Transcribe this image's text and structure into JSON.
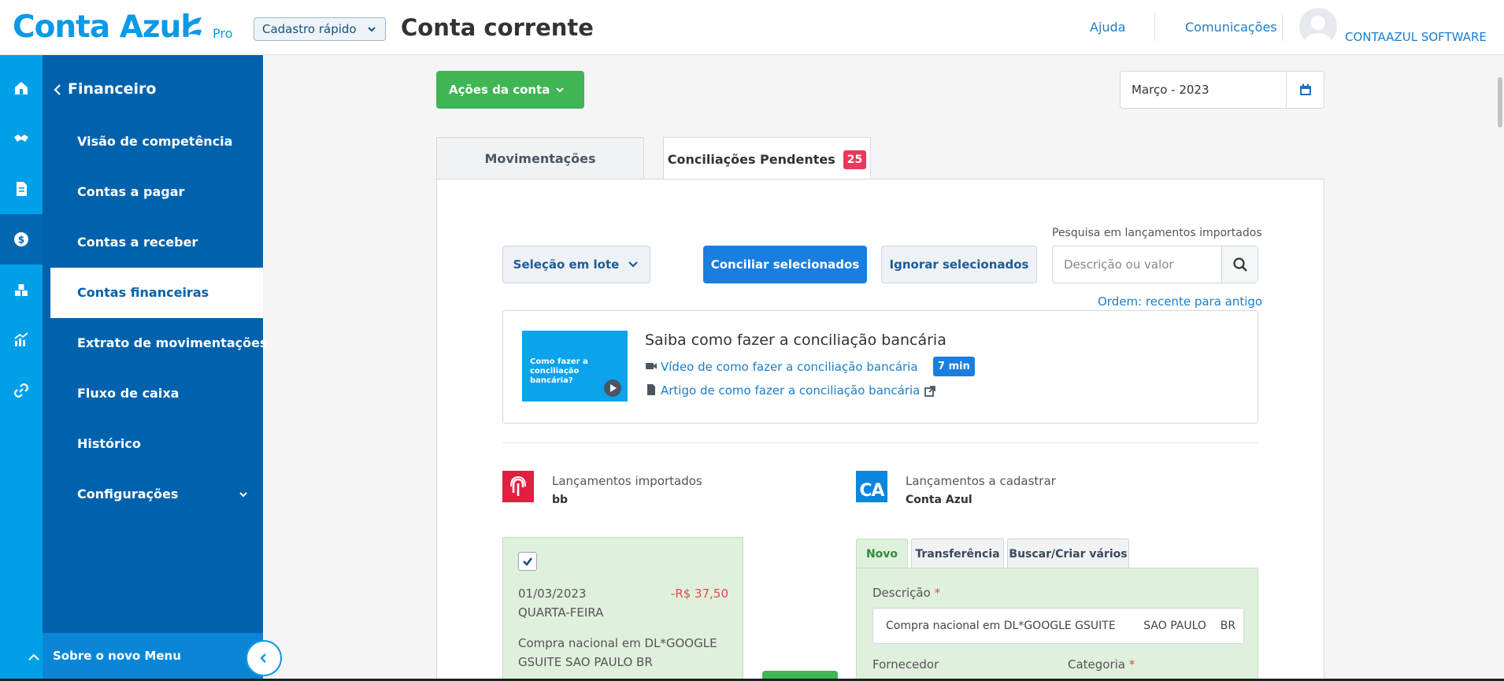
{
  "header": {
    "logo_text": "Conta Azul",
    "plan": "Pro",
    "quick_register": "Cadastro rápido",
    "page_title": "Conta corrente",
    "help": "Ajuda",
    "communications": "Comunicações",
    "company": "CONTAAZUL SOFTWARE"
  },
  "rail": {
    "items": [
      {
        "icon": "home-icon"
      },
      {
        "icon": "handshake-icon"
      },
      {
        "icon": "document-icon"
      },
      {
        "icon": "dollar-icon",
        "active": true
      },
      {
        "icon": "boxes-icon"
      },
      {
        "icon": "chart-icon"
      },
      {
        "icon": "link-icon"
      }
    ]
  },
  "menu": {
    "title": "Financeiro",
    "items": [
      {
        "label": "Visão de competência"
      },
      {
        "label": "Contas a pagar"
      },
      {
        "label": "Contas a receber"
      },
      {
        "label": "Contas financeiras",
        "active": true
      },
      {
        "label": "Extrato de movimentações"
      },
      {
        "label": "Fluxo de caixa"
      },
      {
        "label": "Histórico"
      },
      {
        "label": "Configurações"
      }
    ],
    "footer": "Sobre o novo Menu"
  },
  "toolbar": {
    "account_actions": "Ações da conta",
    "period": "Março - 2023"
  },
  "tabs": {
    "movements": "Movimentações",
    "pending": "Conciliações Pendentes",
    "pending_count": "25"
  },
  "actions": {
    "batch_select": "Seleção em lote",
    "reconcile": "Conciliar selecionados",
    "ignore": "Ignorar selecionados",
    "search_label": "Pesquisa em lançamentos importados",
    "search_placeholder": "Descrição ou valor",
    "order": "Ordem: recente para antigo"
  },
  "help_card": {
    "thumb_text": "Como fazer a conciliação bancária?",
    "title": "Saiba como fazer a conciliação bancária",
    "video_link": "Vídeo de como fazer a conciliação bancária",
    "video_duration": "7 min",
    "article_link": "Artigo de como fazer a conciliação bancária"
  },
  "imported": {
    "label": "Lançamentos importados",
    "bank": "bb"
  },
  "to_register": {
    "label": "Lançamentos a cadastrar",
    "source": "Conta Azul",
    "icon_text": "CA"
  },
  "transaction": {
    "date": "01/03/2023",
    "amount": "-R$ 37,50",
    "weekday": "QUARTA-FEIRA",
    "description": "Compra nacional em DL*GOOGLE GSUITE SAO PAULO BR"
  },
  "form": {
    "tabs": [
      "Novo",
      "Transferência",
      "Buscar/Criar vários"
    ],
    "description_label": "Descrição",
    "description_value": "Compra nacional em DL*GOOGLE GSUITE        SAO PAULO    BR",
    "supplier_label": "Fornecedor",
    "category_label": "Categoria",
    "required_mark": "*"
  },
  "colors": {
    "brand_blue": "#0a9ae6",
    "menu_blue": "#0062ad",
    "green": "#3fb553",
    "primary_button": "#1a7ee0",
    "badge_red": "#f0365b",
    "negative": "#e04b4b"
  }
}
